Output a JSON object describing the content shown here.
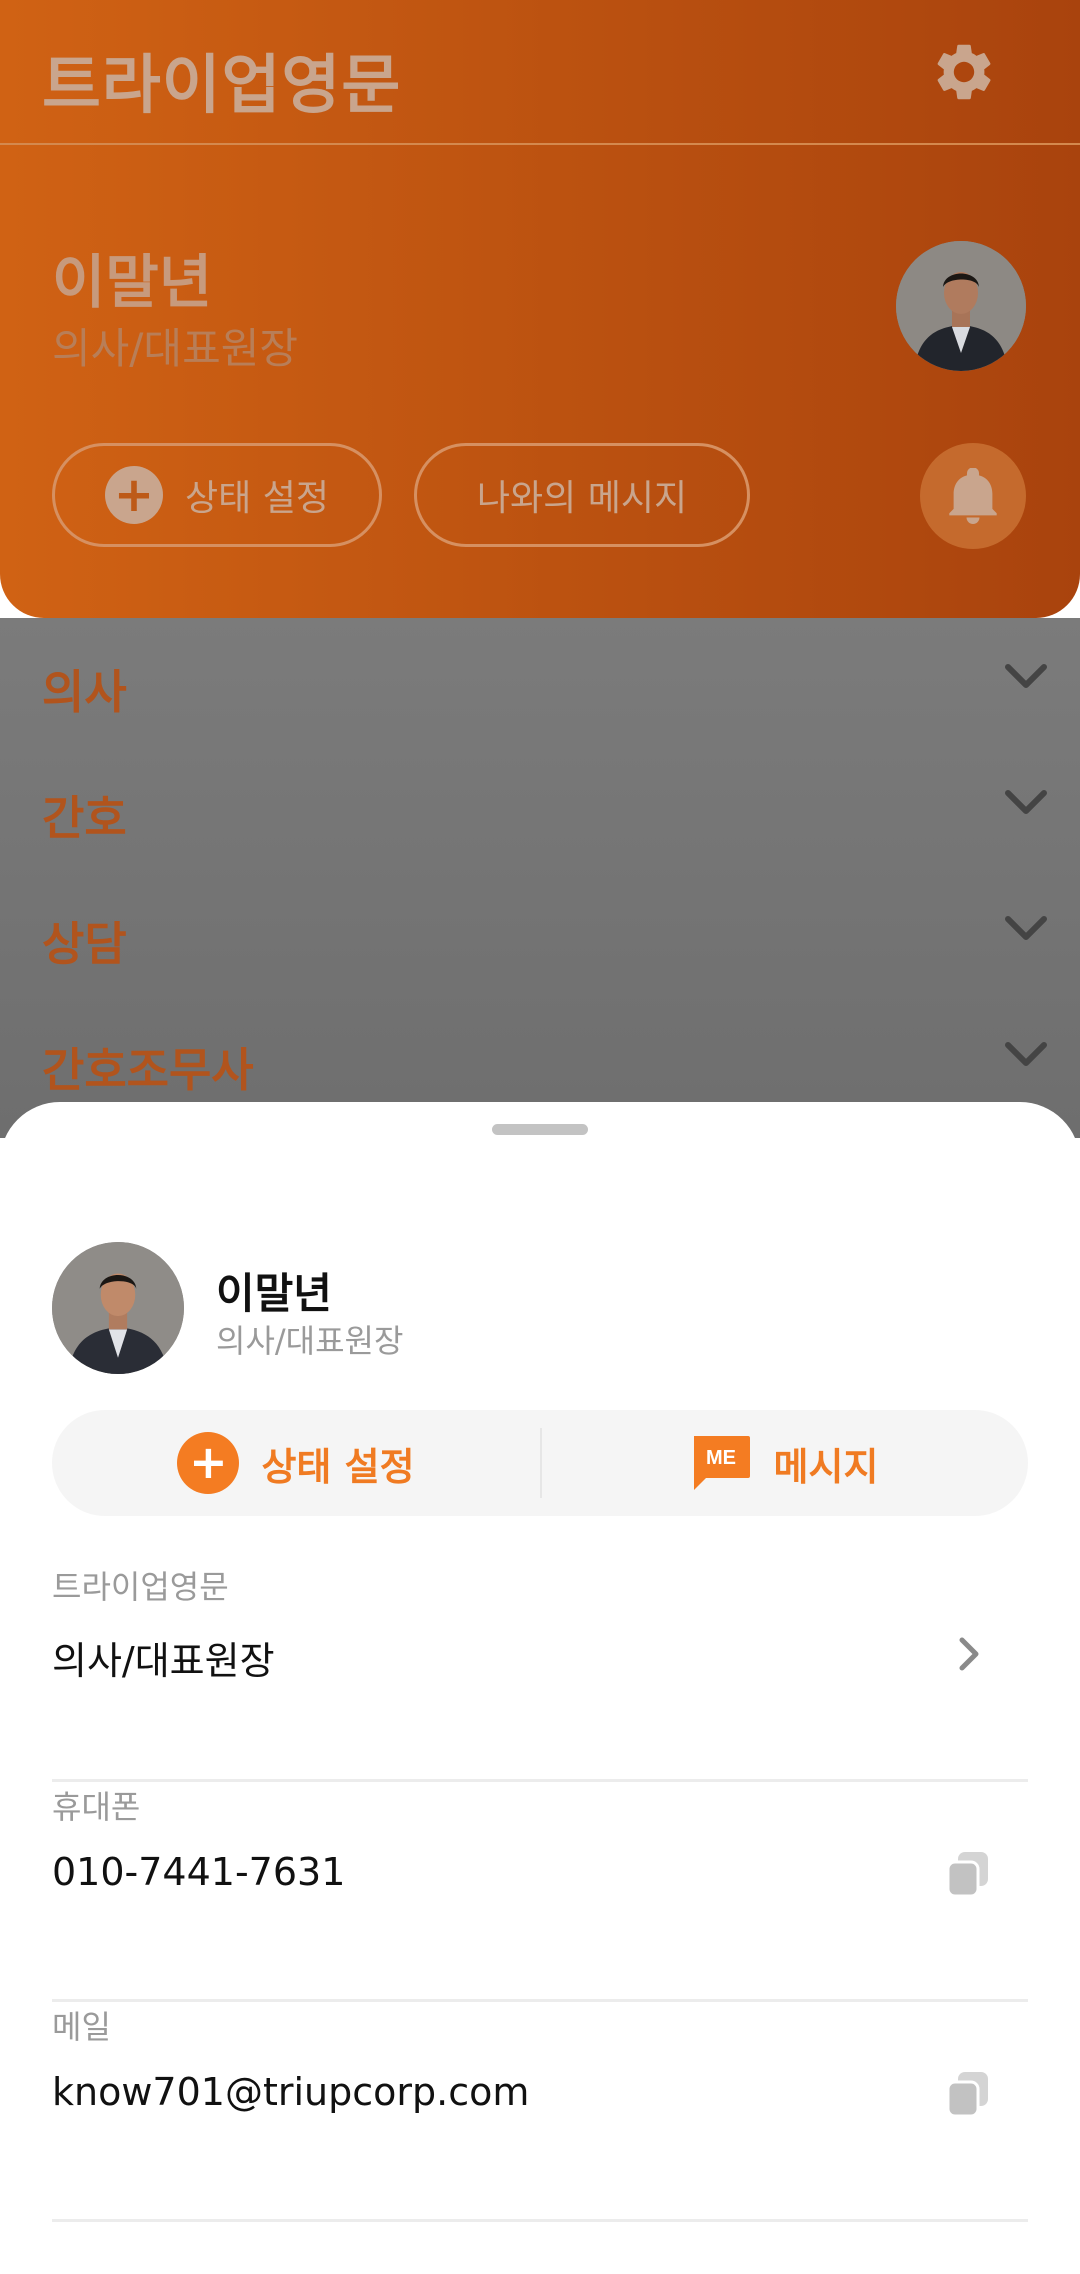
{
  "app": {
    "title": "트라이업영문",
    "accent_color": "#f47c22",
    "settings_icon": "gear-icon"
  },
  "profile": {
    "name": "이말년",
    "role": "의사/대표원장",
    "status_button": "상태 설정",
    "my_message_button": "나와의 메시지",
    "notification_icon": "bell-icon"
  },
  "groups": [
    {
      "label": "의사"
    },
    {
      "label": "간호"
    },
    {
      "label": "상담"
    },
    {
      "label": "간호조무사"
    }
  ],
  "sheet": {
    "name": "이말년",
    "role": "의사/대표원장",
    "actions": {
      "status_label": "상태 설정",
      "message_icon_text": "ME",
      "message_label": "메시지"
    },
    "fields": [
      {
        "label": "트라이업영문",
        "value": "의사/대표원장",
        "action_icon": "chevron-right-icon"
      },
      {
        "label": "휴대폰",
        "value": "010-7441-7631",
        "action_icon": "copy-icon"
      },
      {
        "label": "메일",
        "value": "know701@triupcorp.com",
        "action_icon": "copy-icon"
      }
    ]
  }
}
